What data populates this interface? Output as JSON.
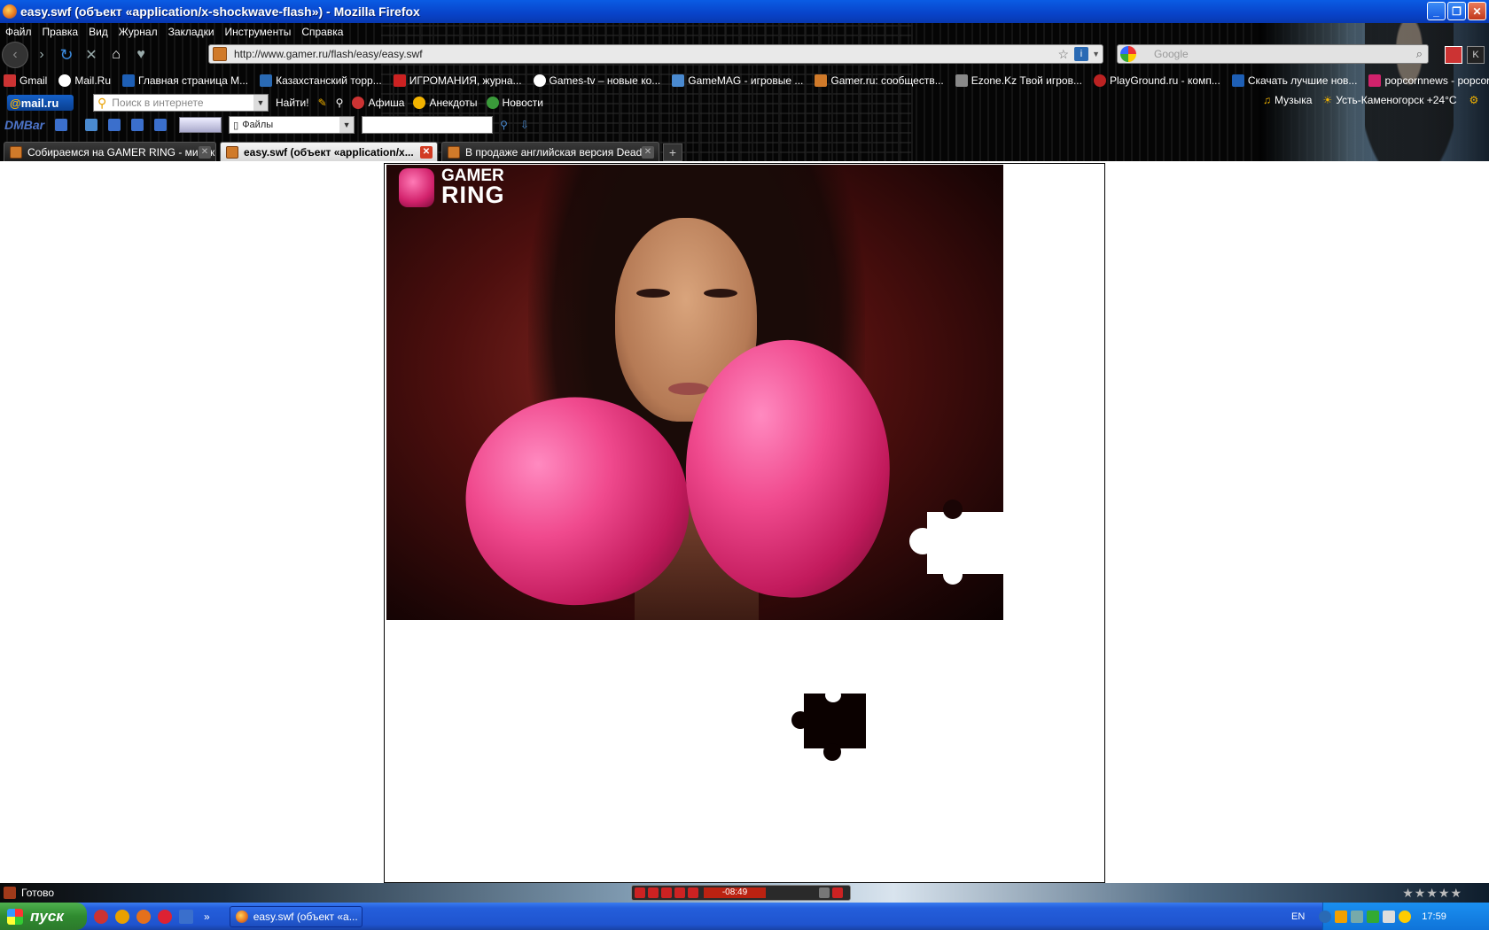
{
  "window": {
    "title": "easy.swf (объект «application/x-shockwave-flash») - Mozilla Firefox",
    "buttons": {
      "minimize": "_",
      "maximize": "❐",
      "close": "✕"
    }
  },
  "menu": [
    "Файл",
    "Правка",
    "Вид",
    "Журнал",
    "Закладки",
    "Инструменты",
    "Справка"
  ],
  "navigation": {
    "url": "http://www.gamer.ru/flash/easy/easy.swf",
    "search_placeholder": "Google"
  },
  "bookmarks": [
    {
      "label": "Gmail",
      "color": "#c33"
    },
    {
      "label": "Mail.Ru",
      "color": "#fff"
    },
    {
      "label": "Главная страница М...",
      "color": "#1e5fb5"
    },
    {
      "label": "Казахстанский торр...",
      "color": "#2a6ab4"
    },
    {
      "label": "ИГРОМАНИЯ, журна...",
      "color": "#c22"
    },
    {
      "label": "Games-tv – новые ко...",
      "color": "#fff"
    },
    {
      "label": "GameMAG - игровые ...",
      "color": "#4a8ad0"
    },
    {
      "label": "Gamer.ru: сообществ...",
      "color": "#d07a2a"
    },
    {
      "label": "Ezone.Kz Твой игров...",
      "color": "#888"
    },
    {
      "label": "PlayGround.ru - комп...",
      "color": "#b22"
    },
    {
      "label": "Скачать лучшие нов...",
      "color": "#1e5fb5"
    },
    {
      "label": "popcornnews - popcor...",
      "color": "#d2226c"
    }
  ],
  "mailru_bar": {
    "logo_prefix": "@",
    "logo_text": "mail.ru",
    "search_placeholder": "Поиск в интернете",
    "find_button": "Найти!",
    "items": [
      {
        "label": "Афиша",
        "color": "#c33"
      },
      {
        "label": "Анекдоты",
        "color": "#f2b300"
      },
      {
        "label": "Новости",
        "color": "#3a9a3a"
      }
    ],
    "music": "Музыка",
    "weather": "Усть-Каменогорск +24°C"
  },
  "dm_bar": {
    "logo": "DMBar",
    "select_value": "Файлы"
  },
  "tabs": [
    {
      "label": "Собираемся на GAMER RING - минико...",
      "active": false
    },
    {
      "label": "easy.swf (объект «application/x...",
      "active": true
    },
    {
      "label": "В продаже английская версия Dead ...",
      "active": false
    }
  ],
  "new_tab": "+",
  "flash": {
    "logo_line1": "GAMER",
    "logo_line2": "RING"
  },
  "status": {
    "text": "Готово",
    "player_time": "-08:49",
    "rating": "★★★★★"
  },
  "taskbar": {
    "start": "пуск",
    "task_label": "easy.swf (объект «а...",
    "language": "EN",
    "clock": "17:59",
    "overflow": "»"
  }
}
